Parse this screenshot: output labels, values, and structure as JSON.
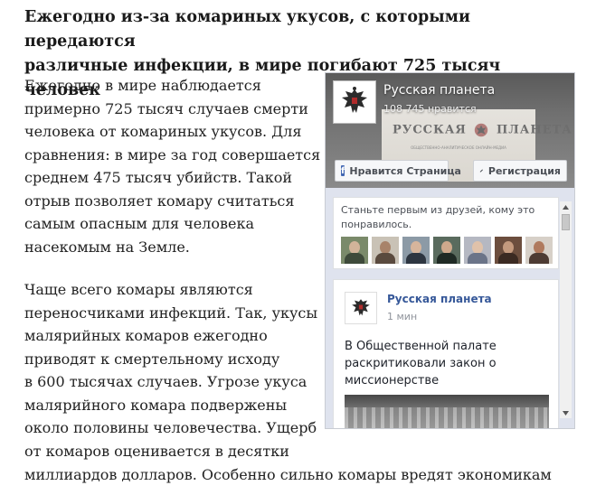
{
  "article": {
    "headline_line1": "Ежегодно из-за комариных укусов, с которыми передаются",
    "headline_line2": "различные инфекции, в мире погибают 725 тысяч человек",
    "paragraph1": [
      "Ежегодно в мире наблюдается",
      "примерно 725 тысяч случаев смерти",
      "человека от комариных укусов. Для",
      "сравнения: в мире за год совершается в",
      "среднем 475 тысяч убийств. Такой",
      "отрыв позволяет комару считаться",
      "самым опасным для человека",
      "насекомым на Земле."
    ],
    "paragraph2": [
      "Чаще всего комары являются",
      "переносчиками инфекций. Так, укусы",
      "малярийных комаров ежегодно",
      "приводят к смертельному исходу",
      "в 600 тысячах случаев. Угрозе укуса",
      "малярийного комара подвержены",
      "около половины человечества. Ущерб",
      "от комаров оценивается в десятки"
    ],
    "last_line": "миллиардов долларов. Особенно сильно комары вредят экономикам"
  },
  "widget": {
    "page_name": "Русская планета",
    "likes": "108 745 нравится",
    "cover_brand_left": "РУССКАЯ",
    "cover_brand_right": "ПЛАНЕТА",
    "cover_subtitle": "ОБЩЕСТВЕННО-АНАЛИТИЧЕСКОЕ ОНЛАЙН-МЕДИА",
    "like_button": "Нравится Страница",
    "register_button": "Регистрация",
    "friends_text": "Станьте первым из друзей, кому это понравилось.",
    "post": {
      "author": "Русская планета",
      "time": "1 мин",
      "text": "В Общественной палате раскритиковали закон о миссионерстве"
    },
    "colors": {
      "fb_blue": "#4267b2",
      "link_blue": "#365899"
    }
  }
}
